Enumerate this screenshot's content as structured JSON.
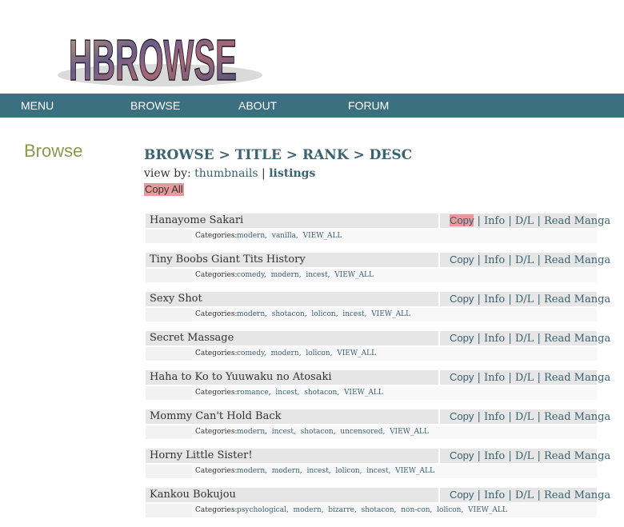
{
  "logo": {
    "text": "HBROWSE"
  },
  "nav": {
    "items": [
      "MENU",
      "BROWSE",
      "ABOUT",
      "FORUM"
    ]
  },
  "sidebar": {
    "title": "Browse"
  },
  "breadcrumb": "BROWSE > TITLE > RANK > DESC",
  "view_by": {
    "label": "view by:",
    "thumbnails": "thumbnails",
    "separator": "|",
    "listings": "listings"
  },
  "copy_all": "Copy All",
  "link_labels": {
    "copy": "Copy",
    "info": "Info",
    "dl": "D/L",
    "read": "Read Manga",
    "sep": "|"
  },
  "categories_label": "Categories:",
  "entries": [
    {
      "title": "Hanayome Sakari",
      "categories": [
        "modern",
        "vanilla",
        "VIEW_ALL"
      ]
    },
    {
      "title": "Tiny Boobs Giant Tits History",
      "categories": [
        "comedy",
        "modern",
        "incest",
        "VIEW_ALL"
      ]
    },
    {
      "title": "Sexy Shot",
      "categories": [
        "modern",
        "shotacon",
        "lolicon",
        "incest",
        "VIEW_ALL"
      ]
    },
    {
      "title": "Secret Massage",
      "categories": [
        "comedy",
        "modern",
        "lolicon",
        "VIEW_ALL"
      ]
    },
    {
      "title": "Haha to Ko to Yuuwaku no Atosaki",
      "categories": [
        "romance",
        "incest",
        "shotacon",
        "VIEW_ALL"
      ]
    },
    {
      "title": "Mommy Can't Hold Back",
      "categories": [
        "modern",
        "incest",
        "shotacon",
        "uncensored",
        "VIEW_ALL"
      ]
    },
    {
      "title": "Horny Little Sister!",
      "categories": [
        "modern",
        "modern",
        "incest",
        "lolicon",
        "incest",
        "VIEW_ALL"
      ]
    },
    {
      "title": "Kankou Bokujou",
      "categories": [
        "psychological",
        "modern",
        "bizarre",
        "shotacon",
        "non-con",
        "lolicon",
        "VIEW_ALL"
      ]
    }
  ],
  "colors": {
    "nav_bg": "#3b7081",
    "accent_link": "#3b6270",
    "highlight": "#e7999c",
    "browse_title": "#8a9a4c"
  }
}
